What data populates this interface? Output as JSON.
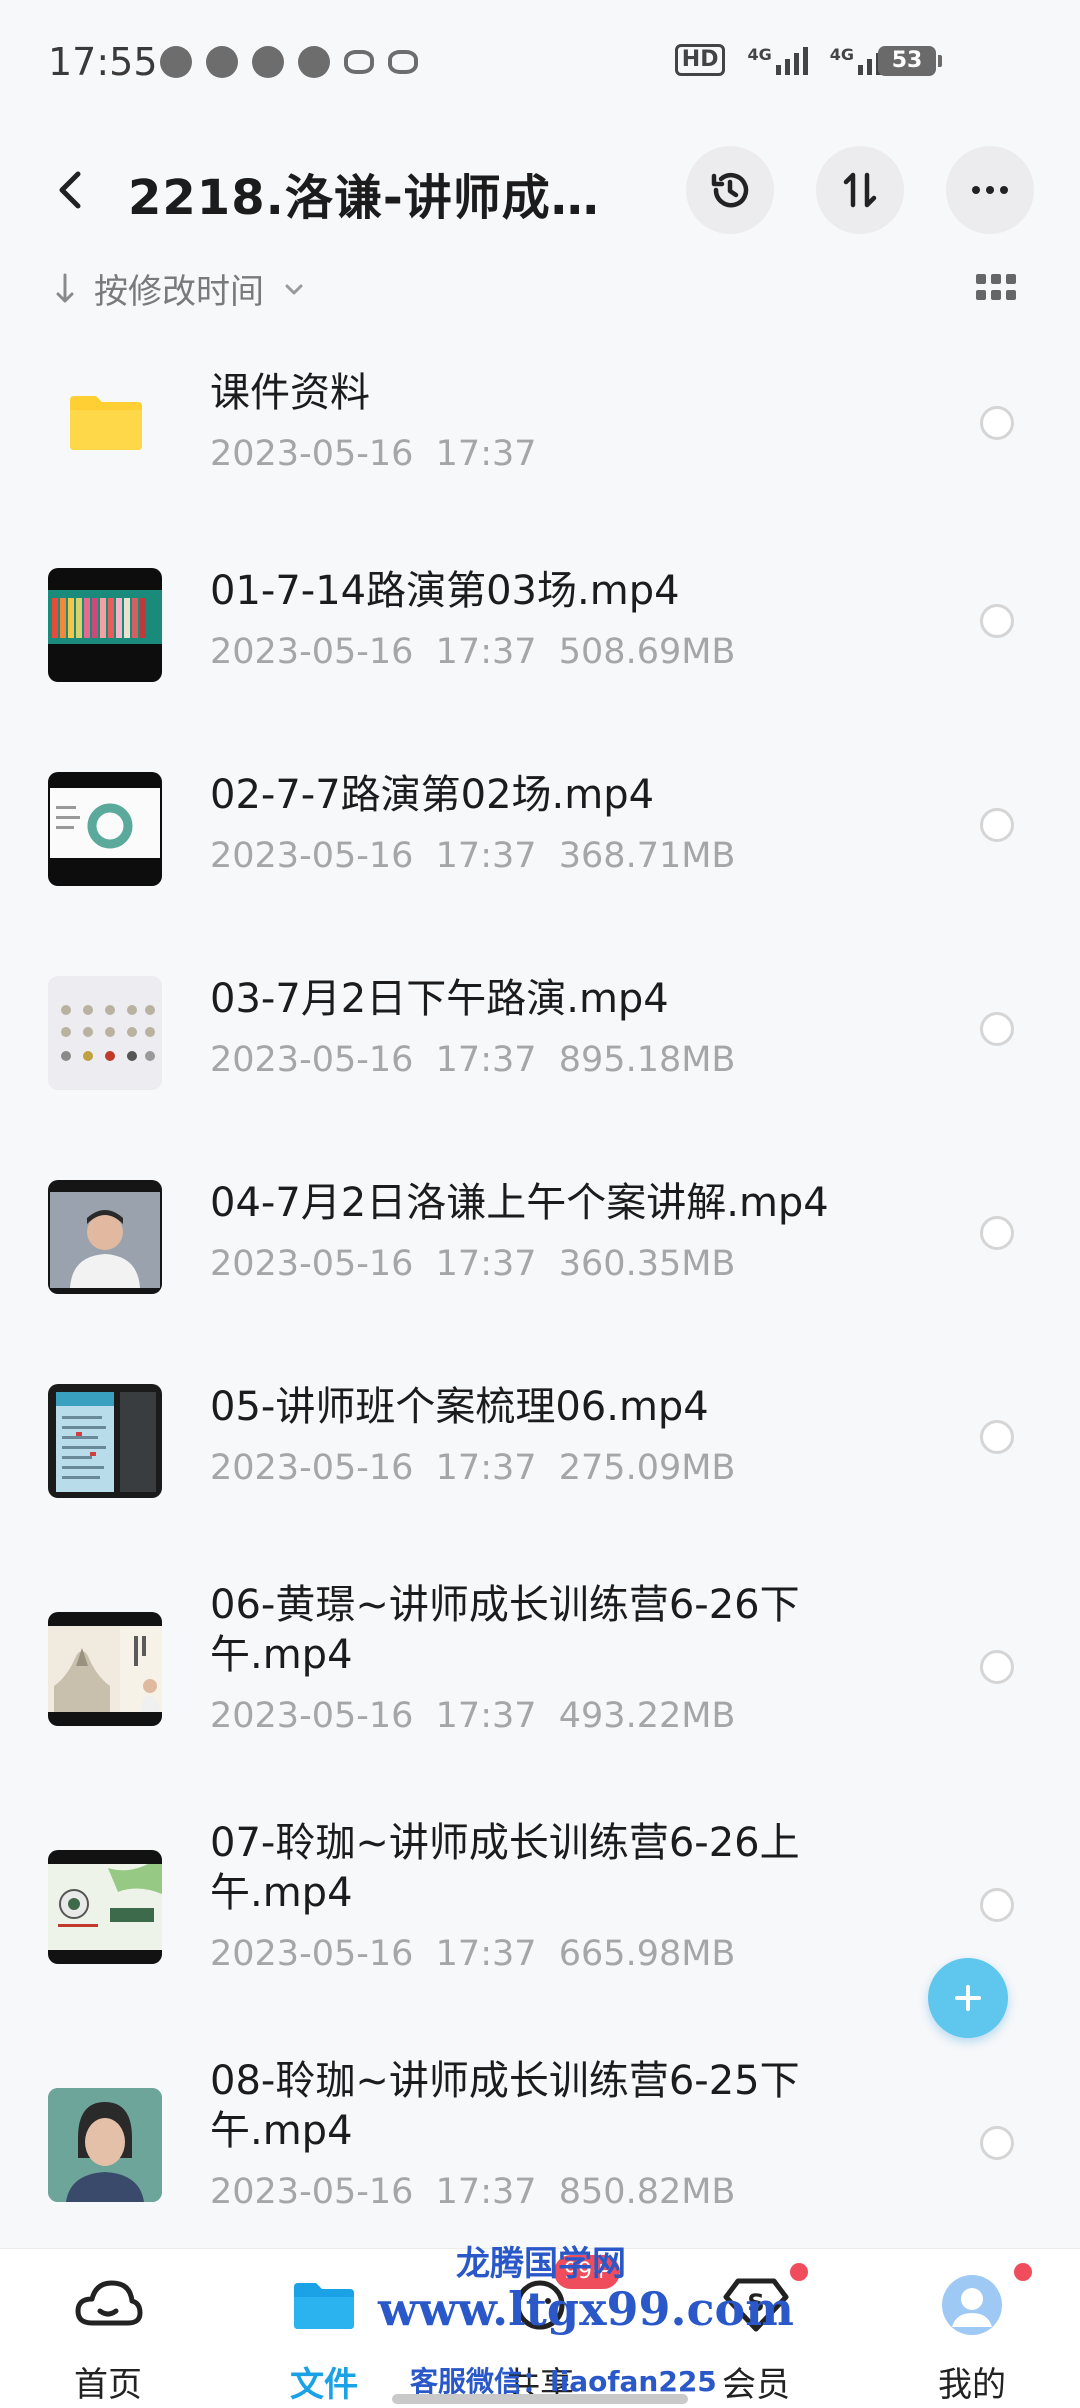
{
  "status_bar": {
    "time": "17:55",
    "hd_label": "HD",
    "network_1": "4G",
    "network_2": "4G",
    "battery": "53"
  },
  "header": {
    "title": "2218.洛谦-讲师成…",
    "back_icon": "chevron-left-icon",
    "actions": [
      "history-icon",
      "sort-swap-icon",
      "more-icon"
    ]
  },
  "sort_bar": {
    "label": "按修改时间",
    "view_icon": "grid-view-icon"
  },
  "files": [
    {
      "name": "课件资料",
      "meta": "2023-05-16  17:37",
      "thumb": "folder"
    },
    {
      "name": "01-7-14路演第03场.mp4",
      "meta": "2023-05-16  17:37  508.69MB",
      "thumb": "pencils"
    },
    {
      "name": "02-7-7路演第02场.mp4",
      "meta": "2023-05-16  17:37  368.71MB",
      "thumb": "chart"
    },
    {
      "name": "03-7月2日下午路演.mp4",
      "meta": "2023-05-16  17:37  895.18MB",
      "thumb": "grid"
    },
    {
      "name": "04-7月2日洛谦上午个案讲解.mp4",
      "meta": "2023-05-16  17:37  360.35MB",
      "thumb": "person"
    },
    {
      "name": "05-讲师班个案梳理06.mp4",
      "meta": "2023-05-16  17:37  275.09MB",
      "thumb": "document"
    },
    {
      "name": "06-黄璟~讲师成长训练营6-26下午.mp4",
      "meta": "2023-05-16  17:37  493.22MB",
      "thumb": "painting"
    },
    {
      "name": "07-聆珈~讲师成长训练营6-26上午.mp4",
      "meta": "2023-05-16  17:37  665.98MB",
      "thumb": "bamboo"
    },
    {
      "name": "08-聆珈~讲师成长训练营6-25下午.mp4",
      "meta": "2023-05-16  17:37  850.82MB",
      "thumb": "woman"
    }
  ],
  "fab": {
    "icon": "plus-icon"
  },
  "bottom_nav": [
    {
      "label": "首页",
      "icon": "cloud-home-icon"
    },
    {
      "label": "文件",
      "icon": "folder-icon"
    },
    {
      "label": "共享",
      "icon": "share-icon",
      "badge": "99+"
    },
    {
      "label": "会员",
      "icon": "vip-diamond-icon"
    },
    {
      "label": "我的",
      "icon": "avatar-icon"
    }
  ],
  "watermark": {
    "line1": "龙腾国学网",
    "line2": "www.ltgx99.com",
    "line3": "客服微信：liaofan225"
  },
  "colors": {
    "accent": "#1aa1e6",
    "fab": "#5fc6ee",
    "badge": "#f04d5c",
    "folder": "#ffcc33",
    "watermark": "#2a58c8"
  }
}
